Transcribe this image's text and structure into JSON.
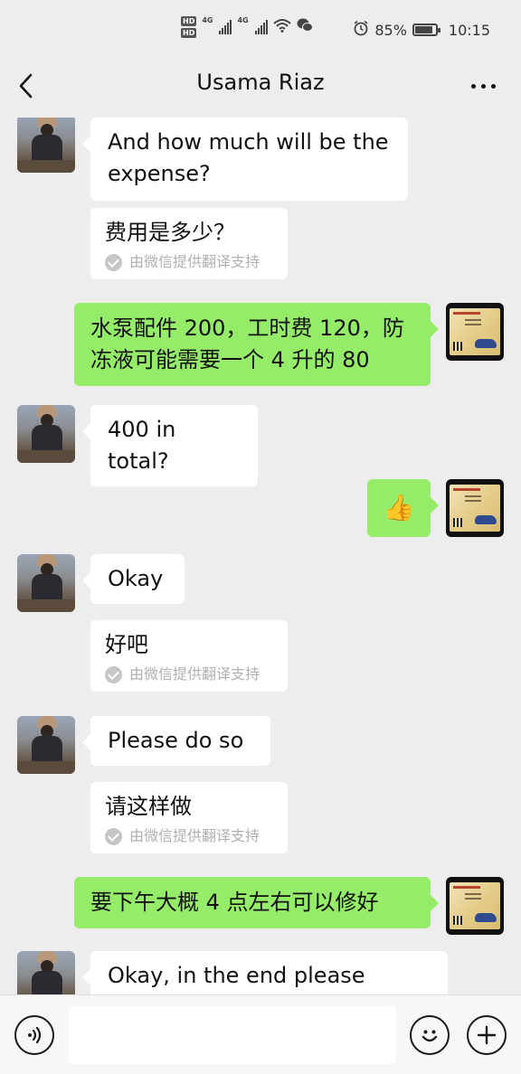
{
  "status_bar": {
    "network_left": "4G",
    "network_right": "4G",
    "hd_label": "HD",
    "battery_percent_text": "85%",
    "battery_level": 0.85,
    "time": "10:15",
    "icons": [
      "hd-icon",
      "signal-icon",
      "wifi-icon",
      "wechat-icon",
      "alarm-icon",
      "battery-icon"
    ]
  },
  "header": {
    "title": "Usama Riaz",
    "back_icon": "chevron-left-icon",
    "more_icon": "more-dots-icon"
  },
  "messages": [
    {
      "side": "in",
      "text": "And how much will be the expense?"
    },
    {
      "side": "in",
      "type": "translation",
      "text": "费用是多少？",
      "note": "由微信提供翻译支持"
    },
    {
      "side": "out",
      "text": "水泵配件 200，工时费 120，防冻液可能需要一个 4 升的 80"
    },
    {
      "side": "in",
      "text": "400 in total?"
    },
    {
      "side": "out",
      "type": "emoji",
      "text": "👍"
    },
    {
      "side": "in",
      "text": "Okay"
    },
    {
      "side": "in",
      "type": "translation",
      "text": "好吧",
      "note": "由微信提供翻译支持"
    },
    {
      "side": "in",
      "text": "Please do so"
    },
    {
      "side": "in",
      "type": "translation",
      "text": "请这样做",
      "note": "由微信提供翻译支持"
    },
    {
      "side": "out",
      "text": "要下午大概 4 点左右可以修好"
    },
    {
      "side": "in",
      "text": "Okay, in the end please check"
    }
  ],
  "input_bar": {
    "voice_icon": "voice-icon",
    "emoji_icon": "emoji-icon",
    "plus_icon": "plus-icon",
    "value": ""
  },
  "colors": {
    "background": "#ededed",
    "incoming_bubble": "#ffffff",
    "outgoing_bubble": "#95ec69",
    "note_text": "#b0b0b0"
  }
}
